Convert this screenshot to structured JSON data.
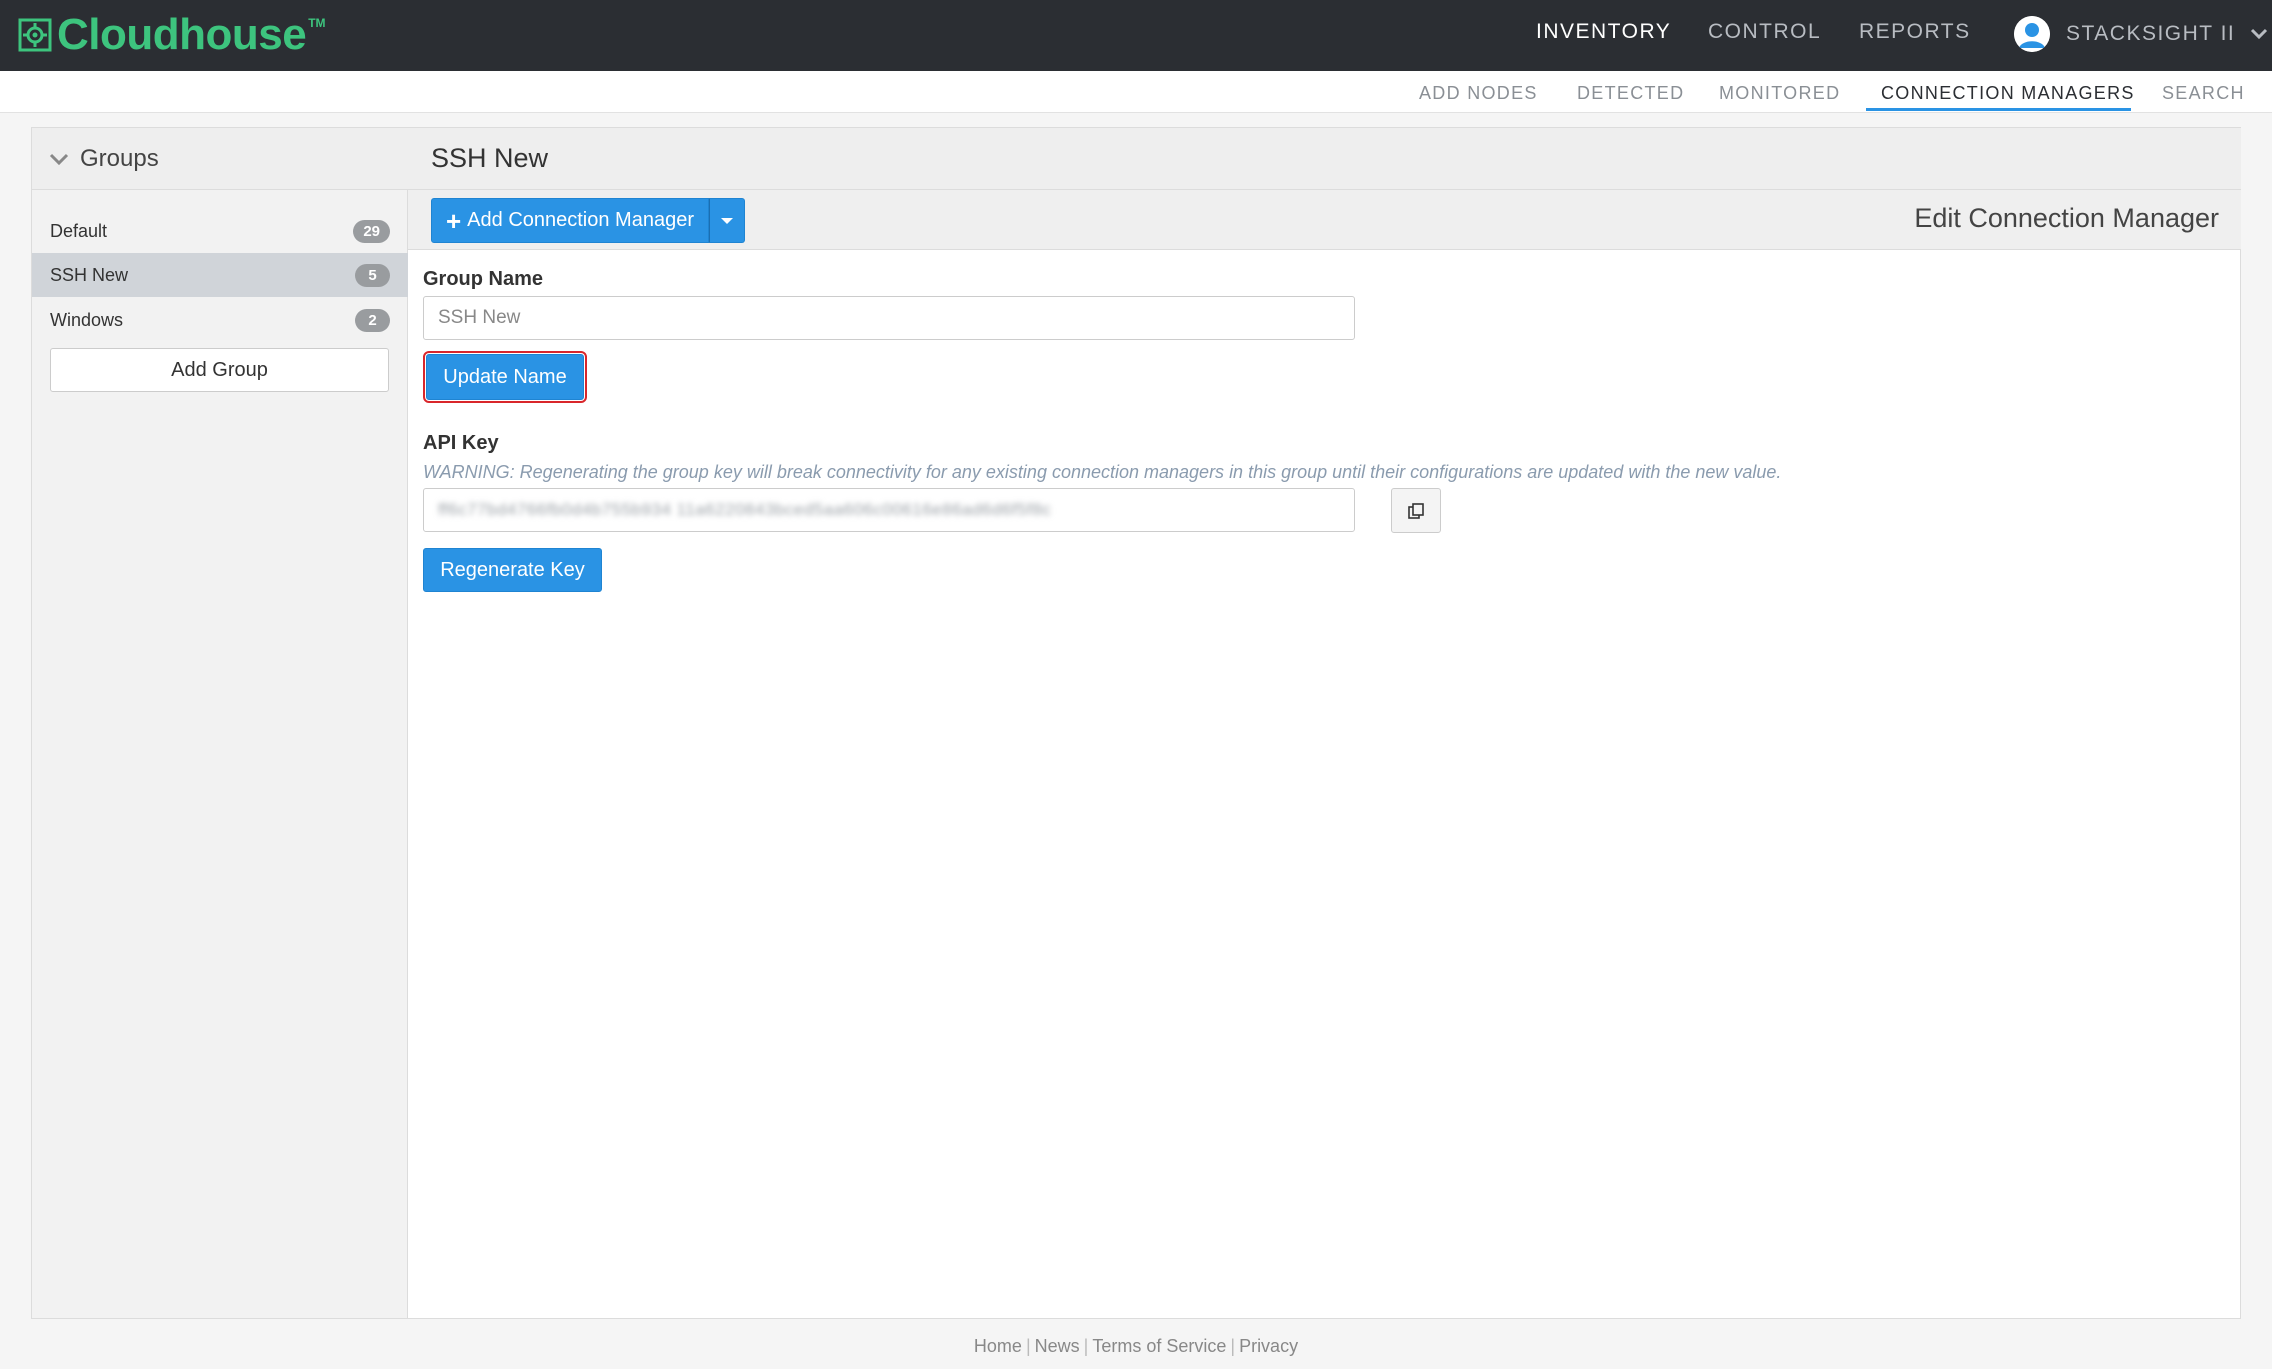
{
  "brand": {
    "name": "Cloudhouse",
    "tm": "TM",
    "color": "#3dc47e"
  },
  "mainnav": {
    "items": [
      {
        "label": "INVENTORY",
        "active": true
      },
      {
        "label": "CONTROL",
        "active": false
      },
      {
        "label": "REPORTS",
        "active": false
      }
    ]
  },
  "user": {
    "name": "STACKSIGHT II",
    "icon": "user-avatar-icon"
  },
  "subnav": {
    "items": [
      {
        "label": "ADD NODES",
        "active": false
      },
      {
        "label": "DETECTED",
        "active": false
      },
      {
        "label": "MONITORED",
        "active": false
      },
      {
        "label": "CONNECTION MANAGERS",
        "active": true
      },
      {
        "label": "SEARCH",
        "active": false
      }
    ]
  },
  "sidebar": {
    "title": "Groups",
    "groups": [
      {
        "name": "Default",
        "count": "29",
        "active": false
      },
      {
        "name": "SSH New",
        "count": "5",
        "active": true
      },
      {
        "name": "Windows",
        "count": "2",
        "active": false
      }
    ],
    "add_group_label": "Add Group"
  },
  "content": {
    "title": "SSH New",
    "add_cm_label": "Add Connection Manager",
    "edit_title": "Edit Connection Manager",
    "group_name_label": "Group Name",
    "group_name_value": "SSH New",
    "update_name_label": "Update Name",
    "api_key_label": "API Key",
    "warning": "WARNING: Regenerating the group key will break connectivity for any existing connection managers in this group until their configurations are updated with the new value.",
    "api_key_value": "ff6c77bd4766fb0d4b755b934 11a6220843bced5aa606c00616e86ad6d6f5f8c",
    "regenerate_label": "Regenerate Key"
  },
  "footer": {
    "links": [
      "Home",
      "News",
      "Terms of Service",
      "Privacy"
    ],
    "separator": "|"
  },
  "colors": {
    "accent": "#2a93e4",
    "topbar": "#2b2e33",
    "highlight_outline": "#d9262b"
  }
}
